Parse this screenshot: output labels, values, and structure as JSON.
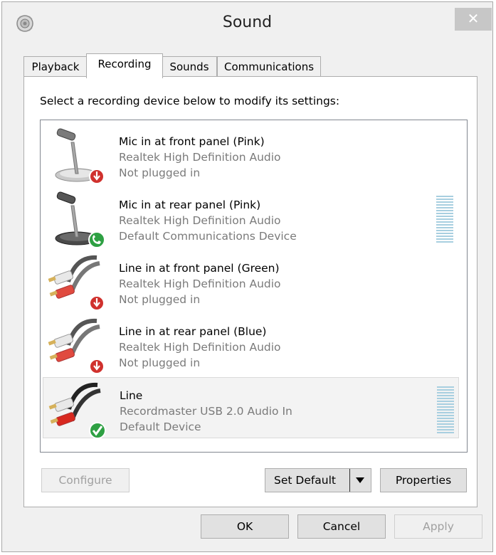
{
  "window": {
    "title": "Sound",
    "close_glyph": "✕"
  },
  "tabs": [
    {
      "label": "Playback"
    },
    {
      "label": "Recording"
    },
    {
      "label": "Sounds"
    },
    {
      "label": "Communications"
    }
  ],
  "active_tab": "Recording",
  "instruction": "Select a recording device below to modify its settings:",
  "devices": [
    {
      "name": "Mic in at front panel (Pink)",
      "driver": "Realtek High Definition Audio",
      "status": "Not plugged in",
      "icon": "microphone-icon",
      "badge": "unplugged-badge-icon"
    },
    {
      "name": "Mic in at rear panel (Pink)",
      "driver": "Realtek High Definition Audio",
      "status": "Default Communications Device",
      "icon": "microphone-icon",
      "badge": "phone-badge-icon"
    },
    {
      "name": "Line in at front panel (Green)",
      "driver": "Realtek High Definition Audio",
      "status": "Not plugged in",
      "icon": "rca-cable-icon",
      "badge": "unplugged-badge-icon"
    },
    {
      "name": "Line in at rear panel (Blue)",
      "driver": "Realtek High Definition Audio",
      "status": "Not plugged in",
      "icon": "rca-cable-icon",
      "badge": "unplugged-badge-icon"
    },
    {
      "name": "Line",
      "driver": "Recordmaster USB 2.0 Audio In",
      "status": "Default Device",
      "icon": "rca-cable-icon",
      "badge": "default-check-badge-icon"
    }
  ],
  "selected_device": "Line",
  "buttons": {
    "configure": "Configure",
    "set_default": "Set Default",
    "properties": "Properties",
    "ok": "OK",
    "cancel": "Cancel",
    "apply": "Apply"
  },
  "colors": {
    "dialog_bg": "#f0f0f0",
    "meter": "#a8cfe0",
    "badge_red": "#d0312d",
    "badge_green": "#2ea043",
    "close_button": "#c7c7c7"
  }
}
